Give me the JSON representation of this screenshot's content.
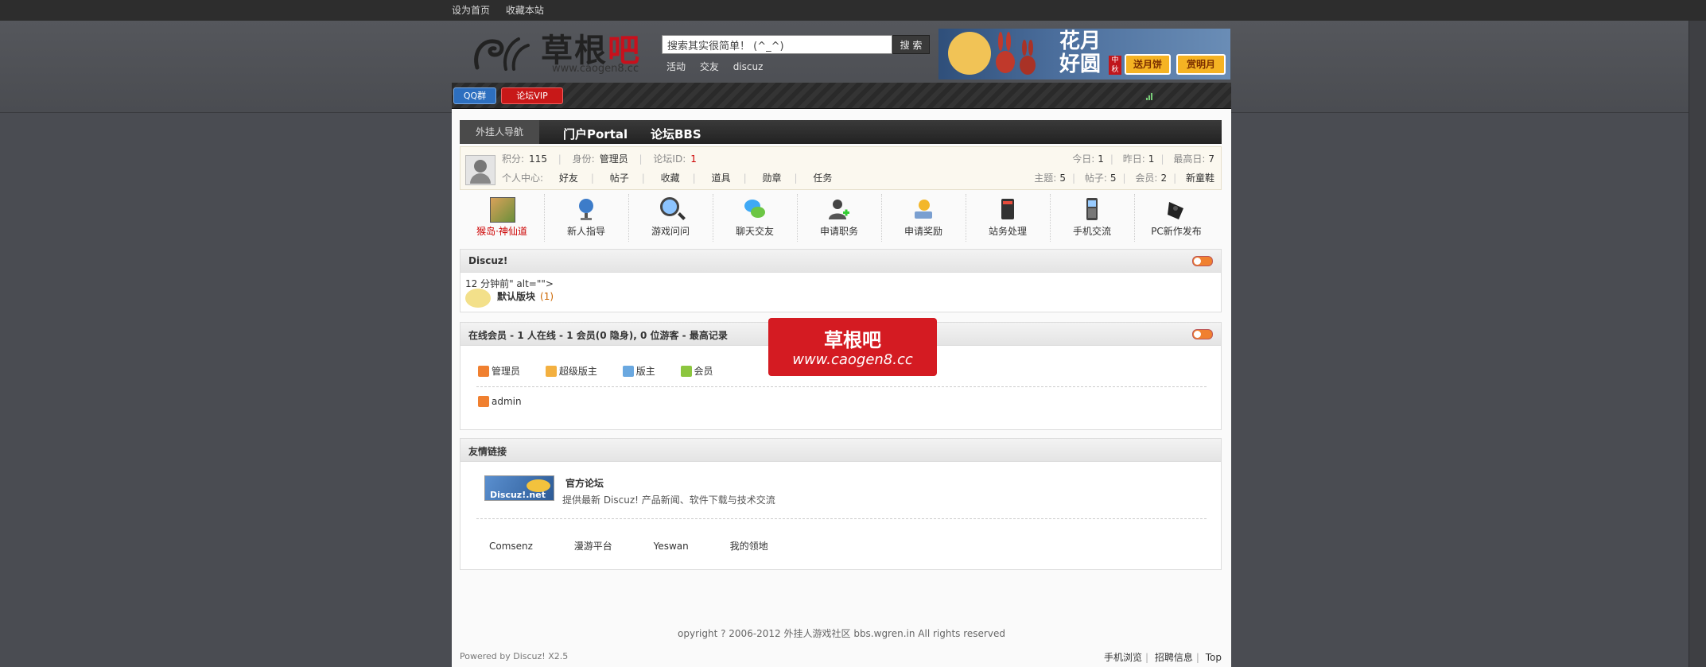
{
  "top_links": [
    "设为首页",
    "收藏本站"
  ],
  "logo": {
    "cn_black": "草根",
    "cn_red": "吧",
    "url": "www.caogen8.cc"
  },
  "search": {
    "value": "搜索其实很简单！ (^_^)",
    "button": "搜 索"
  },
  "hotwords": [
    "活动",
    "交友",
    "discuz"
  ],
  "banner": {
    "title": "花月好圆",
    "tag": "中秋",
    "btn1": "送月饼",
    "btn2": "赏明月"
  },
  "navbar": {
    "qq": "QQ群",
    "vip": "论坛VIP"
  },
  "subnav": {
    "first": "外挂人导航",
    "items": [
      "门户Portal",
      "论坛BBS"
    ]
  },
  "user": {
    "score_label": "积分:",
    "score": "115",
    "role_label": "身份:",
    "role": "管理员",
    "id_label": "论坛ID:",
    "id": "1",
    "center_label": "个人中心:",
    "links": [
      "好友",
      "帖子",
      "收藏",
      "道具",
      "勋章",
      "任务"
    ]
  },
  "stats": {
    "today_label": "今日:",
    "today": "1",
    "yesterday_label": "昨日:",
    "yesterday": "1",
    "max_label": "最高日:",
    "max": "7",
    "threads_label": "主题:",
    "threads": "5",
    "posts_label": "帖子:",
    "posts": "5",
    "members_label": "会员:",
    "members": "2",
    "newest_label": "新童鞋"
  },
  "icons": [
    {
      "label": "猴岛·神仙道",
      "highlight": true
    },
    {
      "label": "新人指导"
    },
    {
      "label": "游戏问问"
    },
    {
      "label": "聊天交友"
    },
    {
      "label": "申请职务"
    },
    {
      "label": "申请奖励"
    },
    {
      "label": "站务处理"
    },
    {
      "label": "手机交流"
    },
    {
      "label": "PC新作发布"
    }
  ],
  "discuz_box": {
    "title": "Discuz!",
    "alt_text": "12 分钟前\" alt=\"\">",
    "forum_name": "默认版块",
    "forum_count": "(1)"
  },
  "online": {
    "title": "在线会员 - 1 人在线 - 1 会员(0 隐身), 0 位游客 - 最高记录",
    "legend": [
      "管理员",
      "超级版主",
      "版主",
      "会员"
    ],
    "members": [
      "admin"
    ]
  },
  "links_box": {
    "title": "友情链接",
    "logo_text": "Discuz!.net",
    "name": "官方论坛",
    "desc": "提供最新 Discuz! 产品新闻、软件下载与技术交流",
    "links": [
      "Comsenz",
      "漫游平台",
      "Yeswan",
      "我的领地"
    ]
  },
  "copyright": "opyright ? 2006-2012 外挂人游戏社区 bbs.wgren.in All rights reserved",
  "powered": "Powered by Discuz! X2.5",
  "footer_links": [
    "手机浏览",
    "招聘信息",
    "Top"
  ],
  "watermark": {
    "title": "草根吧",
    "url": "www.caogen8.cc"
  },
  "colors": {
    "accent_red": "#c8101c",
    "toggle_orange": "#f08030",
    "legend": [
      "#f08030",
      "#f3b040",
      "#6aa8e0",
      "#8cc63f"
    ]
  }
}
